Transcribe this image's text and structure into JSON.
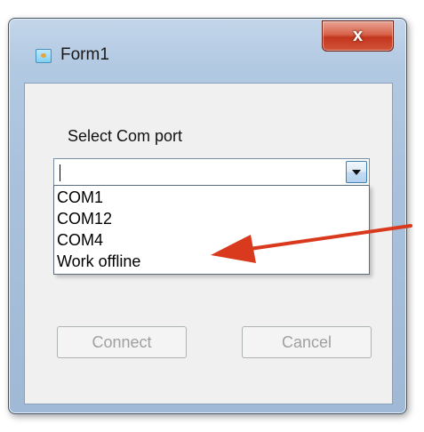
{
  "window": {
    "title": "Form1",
    "close_label": "x"
  },
  "form": {
    "label": "Select Com port",
    "combo_value": "",
    "dropdown_items": [
      "COM1",
      "COM12",
      "COM4",
      "Work offline"
    ]
  },
  "buttons": {
    "connect": "Connect",
    "cancel": "Cancel"
  },
  "colors": {
    "annotation_arrow": "#d93a1e"
  },
  "icons": {
    "app": "form-app-icon",
    "close": "close-icon",
    "dropdown": "chevron-down-icon"
  }
}
